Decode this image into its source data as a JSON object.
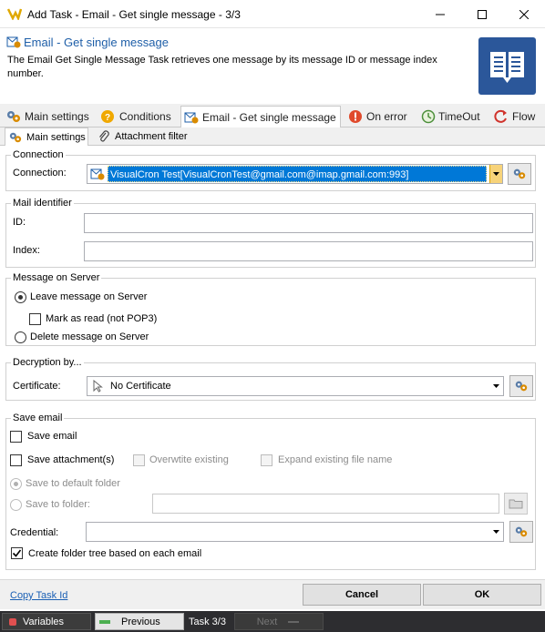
{
  "window": {
    "title": "Add Task - Email - Get single message - 3/3",
    "minimize_icon": "minimize-icon",
    "maximize_icon": "maximize-icon",
    "close_icon": "close-icon"
  },
  "header": {
    "title": "Email - Get single message",
    "description": "The Email Get Single Message Task retrieves one message by its message ID or message index number."
  },
  "main_tabs": [
    {
      "label": "Main settings",
      "icon": "gears-icon"
    },
    {
      "label": "Conditions",
      "icon": "question-icon"
    },
    {
      "label": "Email - Get single message",
      "icon": "email-task-icon"
    },
    {
      "label": "On error",
      "icon": "error-icon"
    },
    {
      "label": "TimeOut",
      "icon": "timeout-icon"
    },
    {
      "label": "Flow",
      "icon": "flow-icon"
    }
  ],
  "sub_tabs": [
    {
      "label": "Main settings",
      "icon": "gears-icon"
    },
    {
      "label": "Attachment filter",
      "icon": "paperclip-icon"
    }
  ],
  "connection": {
    "group_label": "Connection",
    "field_label": "Connection:",
    "value": "VisualCron Test[VisualCronTest@gmail.com@imap.gmail.com:993]"
  },
  "mail_identifier": {
    "group_label": "Mail identifier",
    "id_label": "ID:",
    "id_value": "",
    "index_label": "Index:",
    "index_value": ""
  },
  "message_on_server": {
    "group_label": "Message on Server",
    "leave_label": "Leave message on Server",
    "mark_read_label": "Mark as read (not POP3)",
    "delete_label": "Delete message on Server"
  },
  "decryption": {
    "group_label": "Decryption by...",
    "certificate_label": "Certificate:",
    "certificate_value": "No Certificate"
  },
  "save_email": {
    "group_label": "Save email",
    "save_email_label": "Save email",
    "save_attachments_label": "Save attachment(s)",
    "overwrite_label": "Overwtite existing",
    "expand_label": "Expand existing file name",
    "default_folder_label": "Save to default folder",
    "to_folder_label": "Save to folder:",
    "folder_value": "",
    "credential_label": "Credential:",
    "credential_value": "",
    "create_tree_label": "Create folder tree based on each email"
  },
  "footer": {
    "copy_task_id": "Copy Task Id",
    "cancel": "Cancel",
    "ok": "OK"
  },
  "statusbar": {
    "variables": "Variables",
    "previous": "Previous",
    "task_progress": "Task 3/3",
    "next": "Next"
  },
  "colors": {
    "accent": "#2b579a",
    "selection": "#0078d7",
    "statusbar": "#2d2d30"
  }
}
